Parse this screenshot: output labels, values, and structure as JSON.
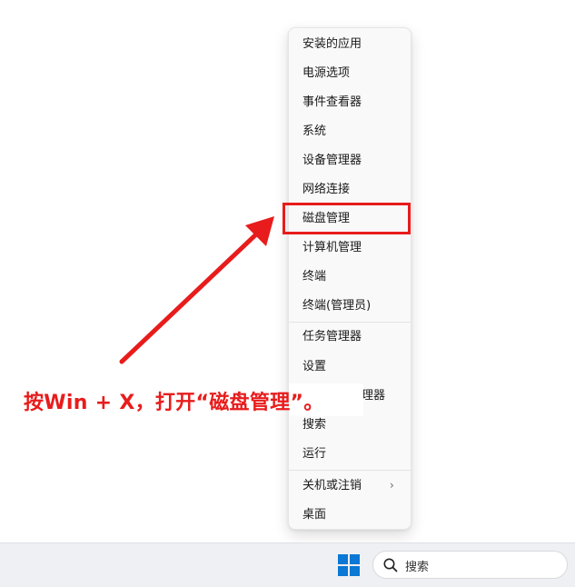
{
  "menu": {
    "items": [
      {
        "label": "安装的应用"
      },
      {
        "label": "电源选项"
      },
      {
        "label": "事件查看器"
      },
      {
        "label": "系统"
      },
      {
        "label": "设备管理器"
      },
      {
        "label": "网络连接"
      },
      {
        "label": "磁盘管理"
      },
      {
        "label": "计算机管理"
      },
      {
        "label": "终端"
      },
      {
        "label": "终端(管理员)"
      },
      {
        "label": "任务管理器"
      },
      {
        "label": "设置"
      },
      {
        "label": "文件资源管理器"
      },
      {
        "label": "搜索"
      },
      {
        "label": "运行"
      },
      {
        "label": "关机或注销"
      },
      {
        "label": "桌面"
      }
    ],
    "submenu_glyph": "›"
  },
  "annotation": {
    "text": "按Win + X，打开“磁盘管理”。",
    "color": "#e81c1c"
  },
  "taskbar": {
    "search_label": "搜索",
    "accent": "#0a78d4"
  }
}
